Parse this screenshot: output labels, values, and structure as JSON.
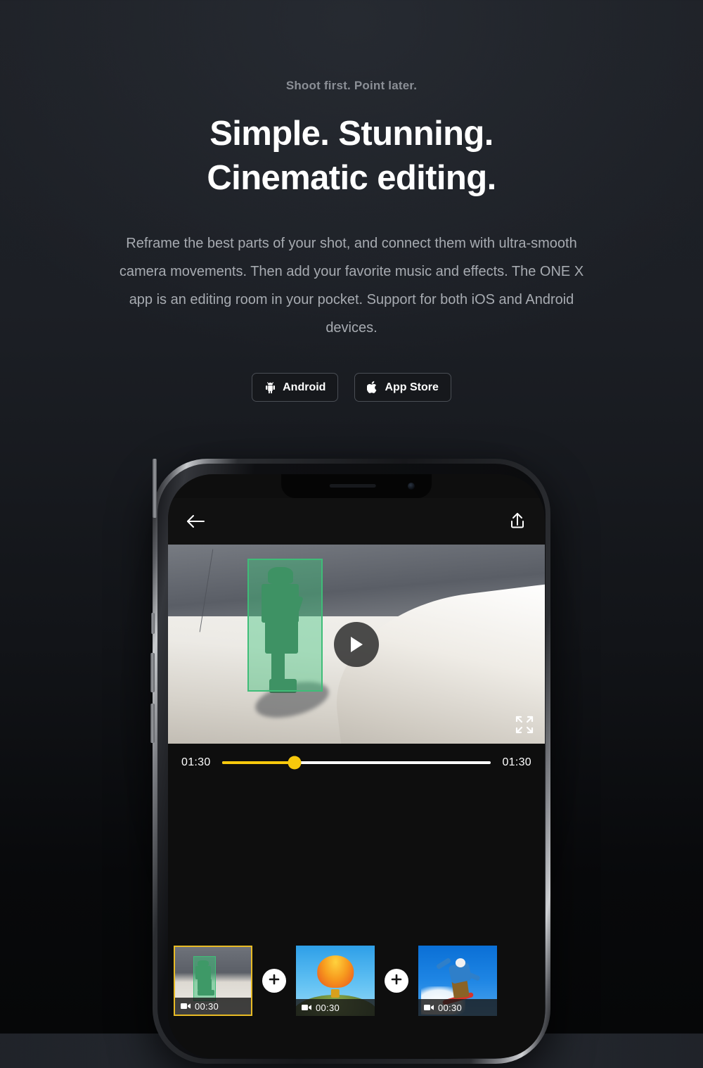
{
  "hero": {
    "eyebrow": "Shoot first. Point later.",
    "headline_line1": "Simple. Stunning.",
    "headline_line2": "Cinematic editing.",
    "body": "Reframe the best parts of your shot, and connect them with ultra-smooth camera movements. Then add your favorite music and effects. The ONE X app is an editing room in your pocket. Support for both iOS and Android devices."
  },
  "store_buttons": [
    {
      "label": "Android",
      "icon": "android-icon"
    },
    {
      "label": "App Store",
      "icon": "apple-icon"
    }
  ],
  "phone_app": {
    "top_bar": {
      "back_icon": "back-arrow-icon",
      "share_icon": "share-upload-icon"
    },
    "preview": {
      "play_icon": "play-icon",
      "fullscreen_icon": "fullscreen-icon",
      "tracking_box_color": "#3fbd78",
      "subject": "skateboarder"
    },
    "scrubber": {
      "current_time": "01:30",
      "total_time": "01:30",
      "progress_percent": 27,
      "accent_color": "#f7c80c"
    },
    "clips": [
      {
        "duration": "00:30",
        "icon": "video-camera-icon",
        "selected": true,
        "art": "skate"
      },
      {
        "duration": "00:30",
        "icon": "video-camera-icon",
        "selected": false,
        "art": "balloon"
      },
      {
        "duration": "00:30",
        "icon": "video-camera-icon",
        "selected": false,
        "art": "snow"
      }
    ],
    "add_buttons": [
      {
        "icon": "plus-icon"
      },
      {
        "icon": "plus-icon"
      }
    ]
  }
}
